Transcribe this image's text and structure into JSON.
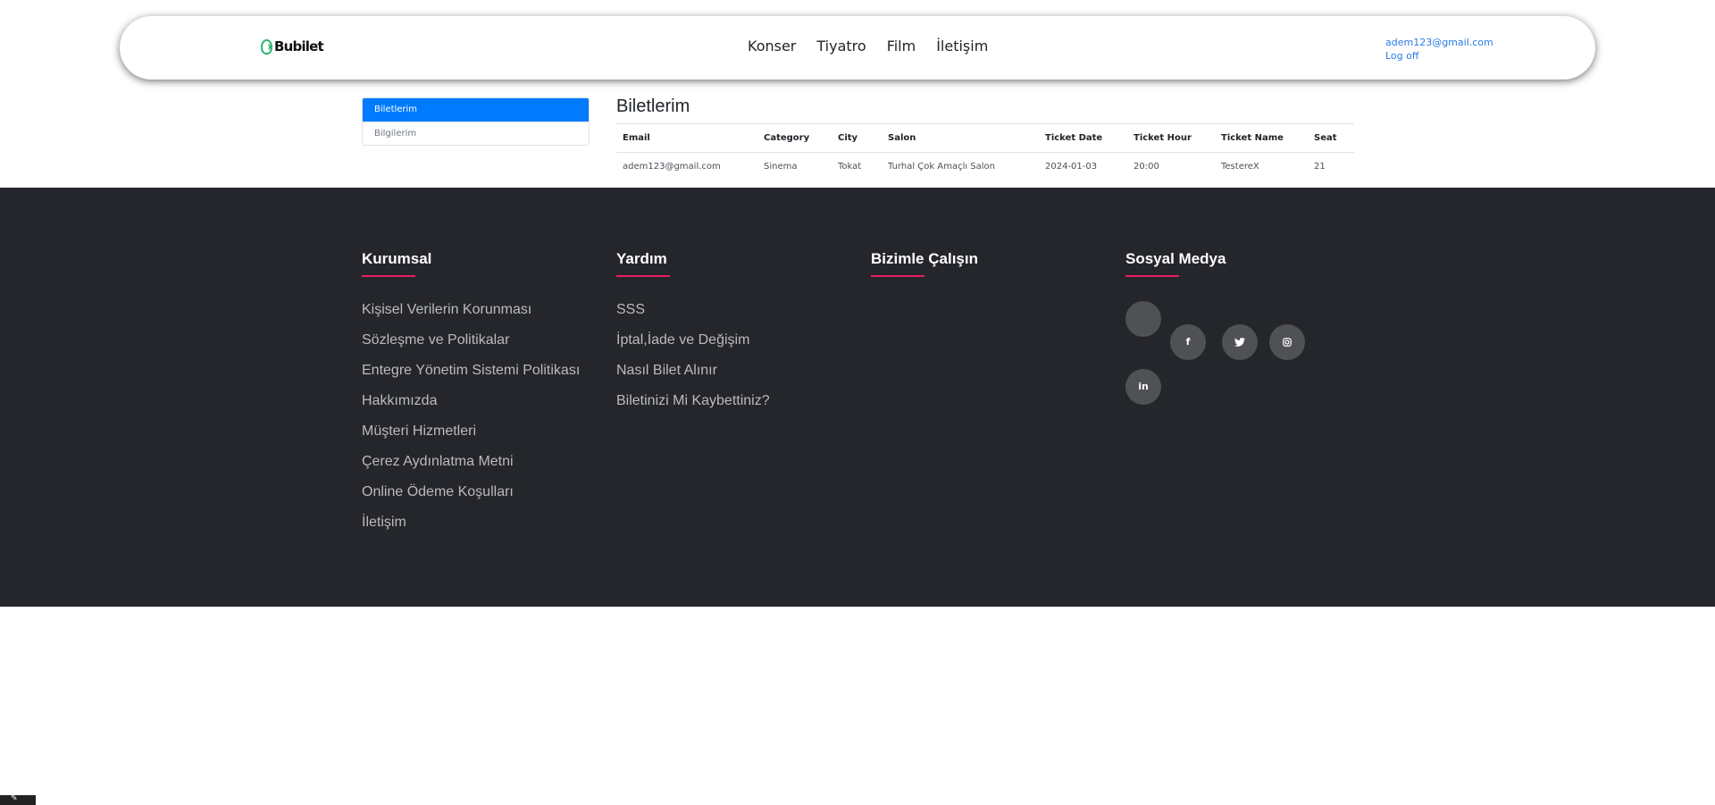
{
  "header": {
    "logo_text": "Bubilet",
    "nav": [
      "Konser",
      "Tiyatro",
      "Film",
      "İletişim"
    ],
    "user_email": "adem123@gmail.com",
    "logout_label": "Log off"
  },
  "sidebar": {
    "items": [
      {
        "label": "Biletlerim",
        "active": true
      },
      {
        "label": "Bilgilerim",
        "active": false
      }
    ]
  },
  "main": {
    "title": "Biletlerim",
    "table": {
      "columns": [
        "Email",
        "Category",
        "City",
        "Salon",
        "Ticket Date",
        "Ticket Hour",
        "Ticket Name",
        "Seat"
      ],
      "rows": [
        [
          "adem123@gmail.com",
          "Sinema",
          "Tokat",
          "Turhal Çok Amaçlı Salon",
          "2024-01-03",
          "20:00",
          "TestereX",
          "21"
        ]
      ]
    }
  },
  "footer": {
    "kurumsal": {
      "title": "Kurumsal",
      "links": [
        "Kişisel Verilerin Korunması",
        "Sözleşme ve Politikalar",
        "Entegre Yönetim Sistemi Politikası",
        "Hakkımızda",
        "Müşteri Hizmetleri",
        "Çerez Aydınlatma Metni",
        "Online Ödeme Koşulları",
        "İletişim"
      ]
    },
    "yardim": {
      "title": "Yardım",
      "links": [
        "SSS",
        "İptal,İade ve Değişim",
        "Nasıl Bilet Alınır",
        "Biletinizi Mi Kaybettiniz?"
      ]
    },
    "calisin": {
      "title": "Bizimle Çalışın"
    },
    "sosyal": {
      "title": "Sosyal Medya",
      "icons": [
        "blank-social-icon",
        "facebook-icon",
        "twitter-icon",
        "instagram-icon",
        "linkedin-icon"
      ],
      "glyphs": [
        "",
        "f",
        "🐦",
        "◎",
        "in"
      ]
    },
    "accent_color": "#e91e63",
    "background_color": "#24262b"
  },
  "colors": {
    "primary": "#007bff",
    "link": "#2a7be4",
    "logo": "#2bb673"
  }
}
